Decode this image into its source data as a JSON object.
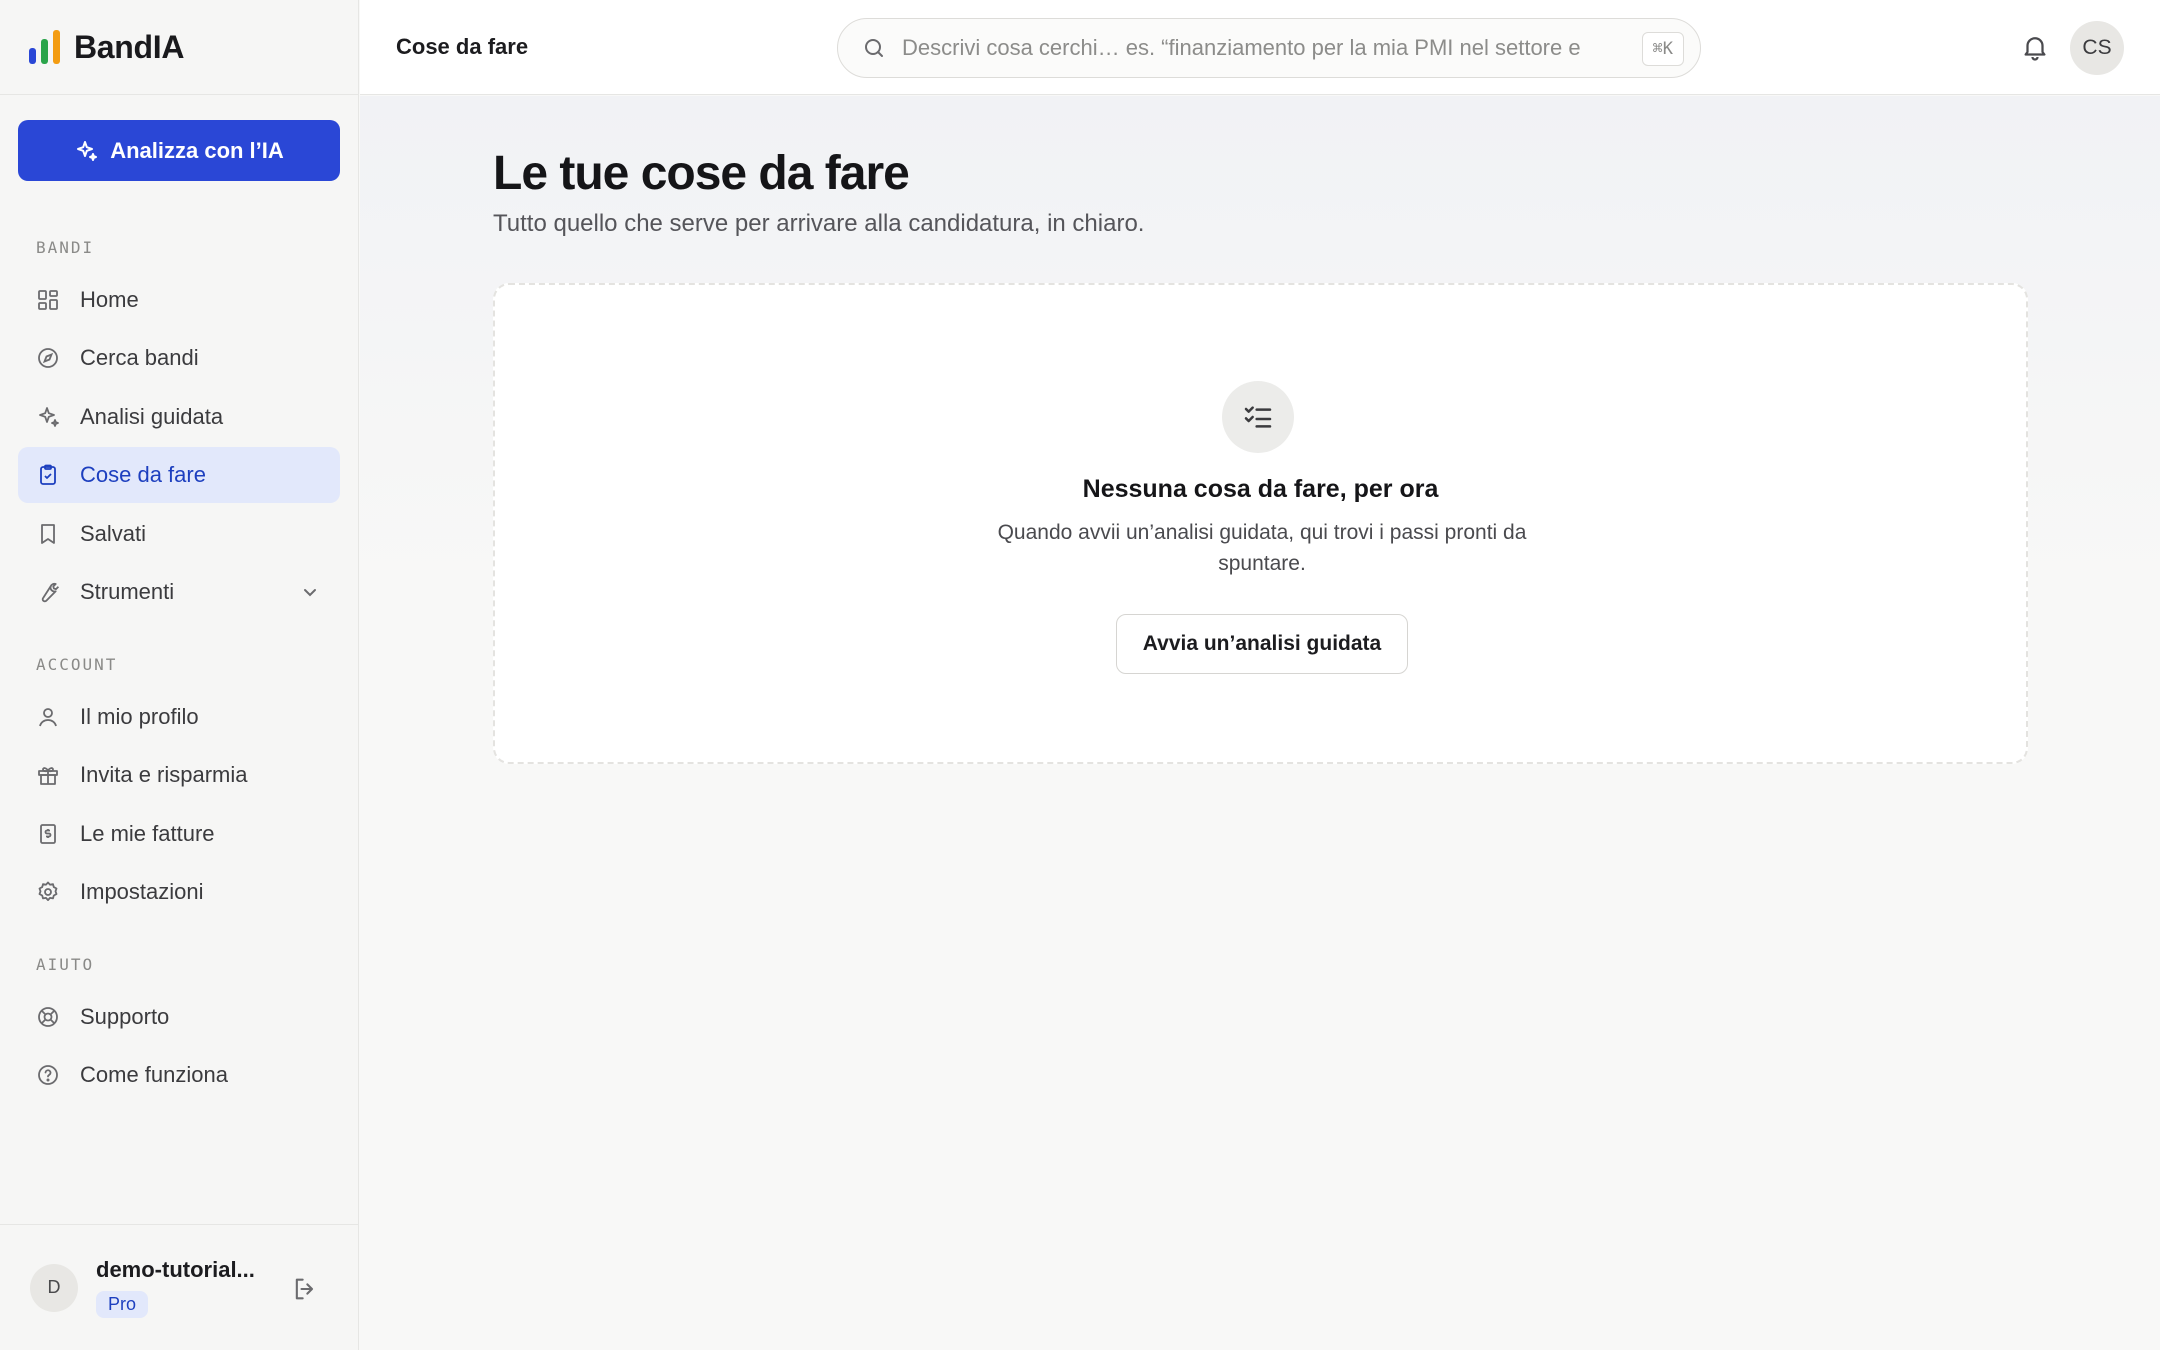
{
  "brand": {
    "name": "BandIA",
    "logo_colors": [
      "#2a47d6",
      "#2aa44a",
      "#f39c12"
    ]
  },
  "colors": {
    "accent": "#2a47d6",
    "active_bg": "#e2e8fb",
    "active_text": "#1d3fbf"
  },
  "sidebar": {
    "cta_label": "Analizza con l’IA",
    "sections": [
      {
        "label": "BANDI",
        "items": [
          {
            "label": "Home",
            "icon": "grid-icon"
          },
          {
            "label": "Cerca bandi",
            "icon": "compass-icon"
          },
          {
            "label": "Analisi guidata",
            "icon": "sparkles-icon"
          },
          {
            "label": "Cose da fare",
            "icon": "clipboard-check-icon",
            "active": true
          },
          {
            "label": "Salvati",
            "icon": "bookmark-icon"
          },
          {
            "label": "Strumenti",
            "icon": "wrench-icon",
            "expandable": true
          }
        ]
      },
      {
        "label": "ACCOUNT",
        "items": [
          {
            "label": "Il mio profilo",
            "icon": "user-icon"
          },
          {
            "label": "Invita e risparmia",
            "icon": "gift-icon"
          },
          {
            "label": "Le mie fatture",
            "icon": "receipt-icon"
          },
          {
            "label": "Impostazioni",
            "icon": "gear-icon"
          }
        ]
      },
      {
        "label": "AIUTO",
        "items": [
          {
            "label": "Supporto",
            "icon": "lifebuoy-icon"
          },
          {
            "label": "Come funziona",
            "icon": "help-circle-icon"
          }
        ]
      }
    ],
    "user": {
      "initial": "D",
      "name": "demo-tutorial...",
      "plan": "Pro"
    }
  },
  "header": {
    "title": "Cose da fare",
    "search_placeholder": "Descrivi cosa cerchi… es. “finanziamento per la mia PMI nel settore e",
    "search_shortcut": "⌘K",
    "avatar_initials": "CS"
  },
  "main": {
    "title": "Le tue cose da fare",
    "subtitle": "Tutto quello che serve per arrivare alla candidatura, in chiaro.",
    "empty_state": {
      "icon": "list-checks-icon",
      "title": "Nessuna cosa da fare, per ora",
      "text": "Quando avvii un’analisi guidata, qui trovi i passi pronti da spuntare.",
      "button_label": "Avvia un’analisi guidata"
    }
  }
}
